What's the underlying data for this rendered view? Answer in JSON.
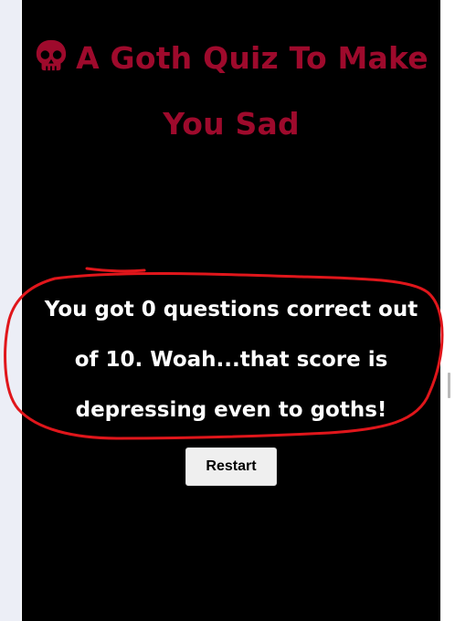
{
  "quiz": {
    "title": "A Goth Quiz To Make You Sad",
    "title_icon": "skull-icon",
    "result_text": "You got 0 questions correct out of 10. Woah...that score is depressing even to goths!",
    "restart_label": "Restart"
  },
  "colors": {
    "background": "#000000",
    "title": "#9e0a2c",
    "result_text": "#ffffff",
    "annotation": "#e0161b",
    "button_bg": "#efefef"
  }
}
